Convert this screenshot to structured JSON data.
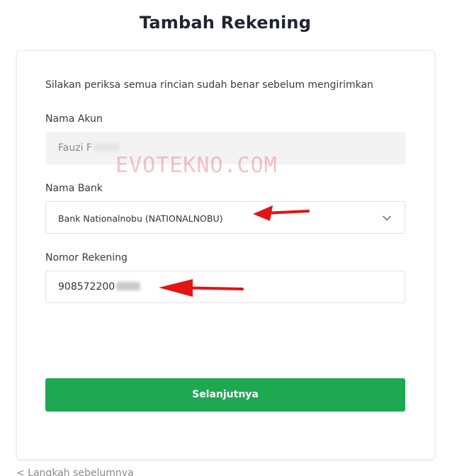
{
  "page": {
    "title": "Tambah Rekening",
    "subtitle": "Silakan periksa semua rincian sudah benar sebelum mengirimkan",
    "back_link": "< Langkah sebelumnya"
  },
  "form": {
    "account_name": {
      "label": "Nama Akun",
      "value": "Fauzi F"
    },
    "bank_name": {
      "label": "Nama Bank",
      "selected": "Bank Nationalnobu (NATIONALNOBU)"
    },
    "account_number": {
      "label": "Nomor Rekening",
      "value": "908572200"
    },
    "submit_label": "Selanjutnya"
  },
  "overlay": {
    "watermark": "EVOTEKNO.COM",
    "arrow_color": "#e31414"
  },
  "colors": {
    "primary": "#1ea852",
    "readonly_bg": "#f3f3f4"
  },
  "icons": {
    "select_chevron": "chevron-down-icon",
    "annotation_arrow": "arrow-left-icon"
  }
}
